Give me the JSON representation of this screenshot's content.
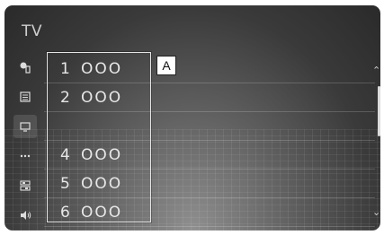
{
  "app": {
    "title": "TV"
  },
  "callout": {
    "label": "A"
  },
  "sidebar": [
    {
      "icon": "source-icon"
    },
    {
      "icon": "program-guide-icon"
    },
    {
      "icon": "tv-icon",
      "active": true
    },
    {
      "icon": "more-icon"
    },
    {
      "icon": "settings-icon"
    },
    {
      "icon": "volume-icon"
    }
  ],
  "channels": [
    {
      "number": "1",
      "name": "OOO"
    },
    {
      "number": "2",
      "name": "OOO"
    },
    {
      "number": "",
      "name": ""
    },
    {
      "number": "4",
      "name": "OOO"
    },
    {
      "number": "5",
      "name": "OOO"
    },
    {
      "number": "6",
      "name": "OOO"
    }
  ],
  "colors": {
    "text": "#e7e7e7",
    "background": "#3a3a3a"
  }
}
